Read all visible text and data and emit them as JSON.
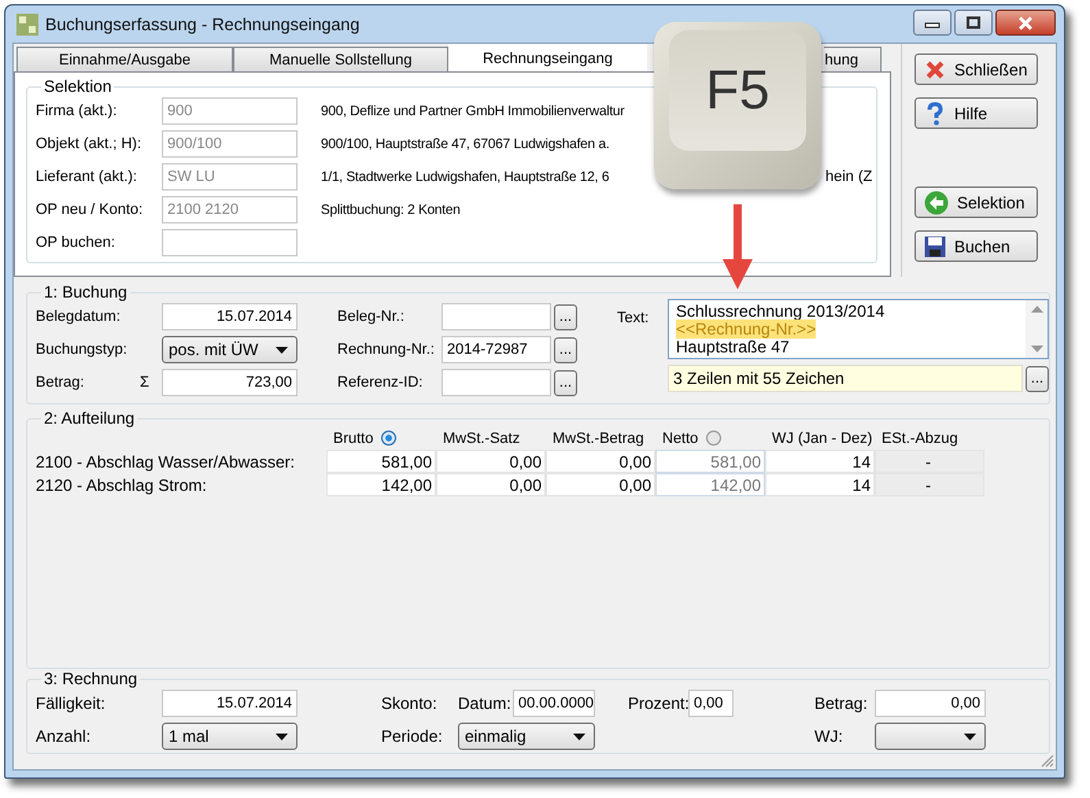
{
  "window": {
    "title": "Buchungserfassung - Rechnungseingang"
  },
  "tabs": [
    {
      "label": "Einnahme/Ausgabe",
      "selected": false
    },
    {
      "label": "Manuelle Sollstellung",
      "selected": false
    },
    {
      "label": "Rechnungseingang",
      "selected": true
    },
    {
      "label": "hung",
      "selected": false
    }
  ],
  "selektion": {
    "title": "Selektion",
    "rows": [
      {
        "label": "Firma (akt.):",
        "value": "900",
        "info": "900,  Deflize und Partner GmbH Immobilienverwaltur"
      },
      {
        "label": "Objekt (akt.; H):",
        "value": "900/100",
        "info": "900/100,  Hauptstraße 47, 67067 Ludwigshafen a."
      },
      {
        "label": "Lieferant (akt.):",
        "value": "SW LU",
        "info": "1/1,  Stadtwerke Ludwigshafen,  Hauptstraße 12, 6",
        "info_tail": "hein  (Z"
      },
      {
        "label": "OP neu / Konto:",
        "value": "2100 2120",
        "info": "Splittbuchung:  2 Konten"
      },
      {
        "label": "OP buchen:"
      }
    ]
  },
  "buttons": [
    {
      "label": "Schließen",
      "kind": "close"
    },
    {
      "label": "Hilfe",
      "kind": "help"
    },
    {
      "label": "Selektion",
      "kind": "back"
    },
    {
      "label": "Buchen",
      "kind": "save"
    }
  ],
  "buchung": {
    "title": "1: Buchung",
    "left": [
      {
        "label": "Belegdatum:",
        "kind": "text",
        "value": "15.07.2014"
      },
      {
        "label": "Buchungstyp:",
        "kind": "dropdown",
        "value": "pos. mit ÜW"
      },
      {
        "label": "Betrag:",
        "kind": "text",
        "prefix": "Σ",
        "value": "723,00"
      }
    ],
    "middle": [
      {
        "label": "Beleg-Nr.:",
        "button": "..."
      },
      {
        "label": "Rechnung-Nr.:",
        "value": "2014-72987",
        "button": "..."
      },
      {
        "label": "Referenz-ID:",
        "button": "..."
      }
    ],
    "text": {
      "label": "Text:",
      "lines": [
        {
          "text": "Schlussrechnung 2013/2014",
          "highlighted": false
        },
        {
          "text": "<<Rechnung-Nr.>>",
          "highlighted": true
        },
        {
          "text": "Hauptstraße 47",
          "highlighted": false
        }
      ],
      "info": "3 Zeilen mit 55 Zeichen",
      "button": "..."
    }
  },
  "aufteilung": {
    "title": "2: Aufteilung",
    "columns": [
      {
        "label": "Brutto",
        "kind": "input",
        "selected": true
      },
      {
        "label": "MwSt.-Satz",
        "kind": "input"
      },
      {
        "label": "MwSt.-Betrag",
        "kind": "input"
      },
      {
        "label": "Netto",
        "kind": "readonly",
        "selected": false
      },
      {
        "label": "WJ (Jan - Dez)",
        "kind": "input"
      },
      {
        "label": "ESt.-Abzug",
        "kind": "disabled"
      }
    ],
    "rows": [
      {
        "label": "2100 - Abschlag Wasser/Abwasser:",
        "cells": [
          "581,00",
          "0,00",
          "0,00",
          "581,00",
          "14",
          "-"
        ]
      },
      {
        "label": "2120 - Abschlag Strom:",
        "cells": [
          "142,00",
          "0,00",
          "0,00",
          "142,00",
          "14",
          "-"
        ]
      }
    ]
  },
  "rechnung": {
    "title": "3: Rechnung",
    "faelligkeit": {
      "label": "Fälligkeit:",
      "value": "15.07.2014"
    },
    "skonto": "Skonto:",
    "datum": {
      "label": "Datum:",
      "value": "00.00.0000"
    },
    "prozent": {
      "label": "Prozent:",
      "value": "0,00"
    },
    "betrag": {
      "label": "Betrag:",
      "value": "0,00"
    },
    "anzahl": {
      "label": "Anzahl:",
      "value": "1 mal"
    },
    "periode": {
      "label": "Periode:",
      "value": "einmalig"
    },
    "wj": {
      "label": "WJ:"
    }
  },
  "overlay": {
    "key": "F5"
  }
}
